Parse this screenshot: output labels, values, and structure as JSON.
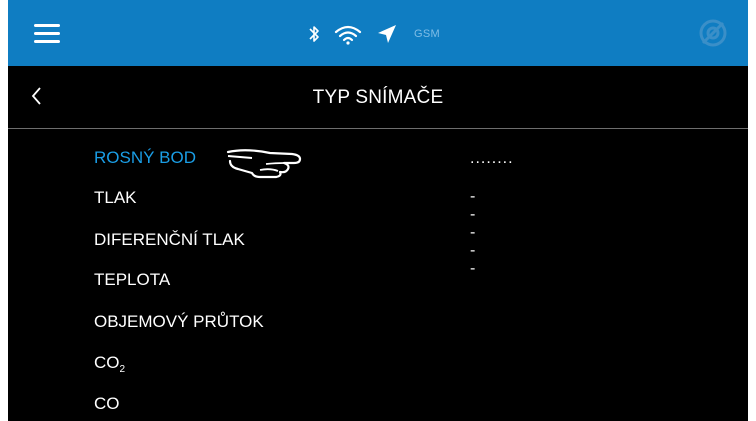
{
  "statusbar": {
    "gsm_label": "GSM",
    "icons": [
      "menu-icon",
      "bluetooth-icon",
      "wifi-icon",
      "navigation-arrow-icon",
      "target-icon"
    ],
    "colors": {
      "bar": "#0f7dc2",
      "background": "#000000",
      "accent": "#1a9ee6"
    }
  },
  "header": {
    "title": "TYP SNÍMAČE",
    "back_icon": "chevron-left-icon"
  },
  "sensor_list": {
    "items": [
      {
        "label": "ROSNÝ BOD",
        "value": "........",
        "selected": true
      },
      {
        "label": "TLAK",
        "value": "-----"
      },
      {
        "label": "DIFERENČNÍ TLAK"
      },
      {
        "label": "TEPLOTA"
      },
      {
        "label": "OBJEMOVÝ PRŮTOK"
      },
      {
        "label": "CO",
        "subscript": "2"
      },
      {
        "label": "CO"
      }
    ],
    "selection_indicator": "pointing-hand-icon"
  }
}
